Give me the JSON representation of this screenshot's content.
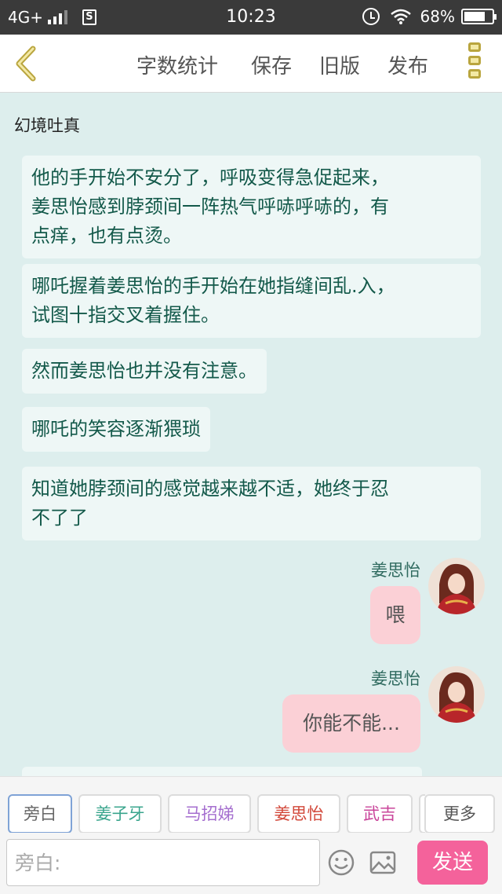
{
  "status_bar": {
    "network": "4G+",
    "time": "10:23",
    "battery": "68%"
  },
  "toolbar": {
    "items": [
      "字数统计",
      "保存",
      "旧版",
      "发布"
    ]
  },
  "chat": {
    "world_title": "幻境吐真",
    "narrations": [
      {
        "lines": [
          "他的手开始不安分了，呼吸变得急促起来，",
          "姜思怡感到脖颈间一阵热气呼哧呼哧的，有",
          "点痒，也有点烫。"
        ]
      },
      {
        "lines": [
          "哪吒握着姜思怡的手开始在她指缝间乱.入，",
          "试图十指交叉着握住。"
        ]
      },
      {
        "lines": [
          "然而姜思怡也并没有注意。"
        ]
      },
      {
        "lines": [
          "哪吒的笑容逐渐猥琐"
        ]
      },
      {
        "lines": [
          "知道她脖颈间的感觉越来越不适，她终于忍",
          "不了了"
        ]
      }
    ],
    "messages": [
      {
        "speaker": "姜思怡",
        "text": "喂"
      },
      {
        "speaker": "姜思怡",
        "text": "你能不能..."
      }
    ]
  },
  "characters": [
    {
      "label": "旁白",
      "color": "#666666"
    },
    {
      "label": "姜子牙",
      "color": "#3aa58d"
    },
    {
      "label": "马招娣",
      "color": "#a56fcf"
    },
    {
      "label": "姜思怡",
      "color": "#d2483a"
    },
    {
      "label": "武吉",
      "color": "#c9449a"
    },
    {
      "label": "更多",
      "color": "#555555"
    }
  ],
  "input": {
    "placeholder": "旁白:",
    "send_label": "发送"
  },
  "colors": {
    "accent_pink": "#f4629b",
    "chat_bg": "#ddeeed",
    "narration_text": "#13594a"
  }
}
